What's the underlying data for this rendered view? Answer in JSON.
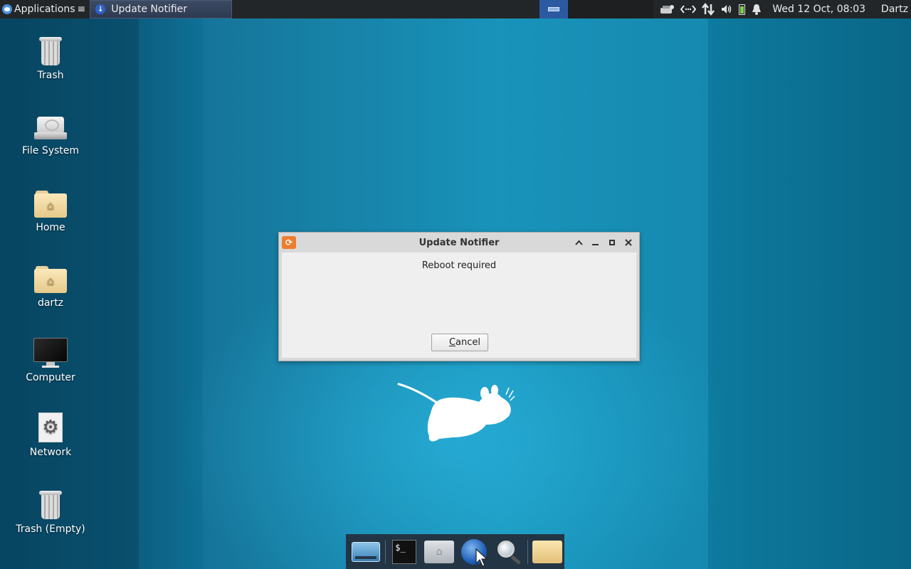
{
  "top_panel": {
    "applications_label": "Applications",
    "applications_arrow": "≡",
    "task_title": "Update Notifier",
    "clock": "Wed 12 Oct, 08:03",
    "user": "Dartz",
    "tray_icons": [
      "network-manager-icon",
      "network-arrows-icon",
      "updown-arrows-icon",
      "volume-icon",
      "battery-icon",
      "notification-bell-icon"
    ]
  },
  "desktop": {
    "icons": [
      {
        "label": "Trash",
        "icon": "trash-icon"
      },
      {
        "label": "File System",
        "icon": "hard-drive-icon"
      },
      {
        "label": "Home",
        "icon": "home-folder-icon"
      },
      {
        "label": "dartz",
        "icon": "home-folder-icon"
      },
      {
        "label": "Computer",
        "icon": "monitor-icon"
      },
      {
        "label": "Network",
        "icon": "settings-gear-icon"
      },
      {
        "label": "Trash (Empty)",
        "icon": "trash-icon"
      }
    ]
  },
  "dialog": {
    "title": "Update Notifier",
    "message": "Reboot required",
    "cancel_label": "Cancel",
    "cancel_mnemonic": "C",
    "cancel_rest": "ancel"
  },
  "dock": {
    "items": [
      "show-desktop-icon",
      "terminal-icon",
      "file-manager-icon",
      "web-browser-icon",
      "app-finder-icon",
      "files-folder-icon"
    ]
  },
  "colors": {
    "panel_bg": "#232628",
    "desktop_blue": "#1290b8",
    "dialog_body": "#efefef",
    "dock_bg": "#233544"
  }
}
